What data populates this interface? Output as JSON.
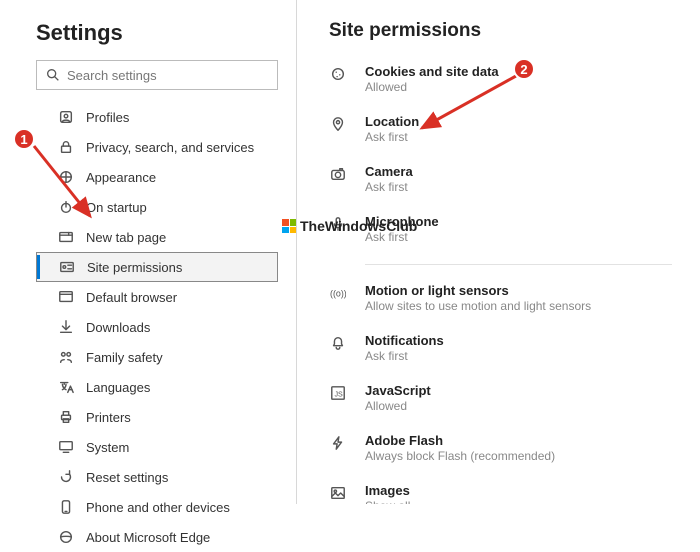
{
  "sidebar": {
    "title": "Settings",
    "search_placeholder": "Search settings",
    "items": [
      {
        "label": "Profiles",
        "icon": "profile-icon"
      },
      {
        "label": "Privacy, search, and services",
        "icon": "lock-icon"
      },
      {
        "label": "Appearance",
        "icon": "appearance-icon"
      },
      {
        "label": "On startup",
        "icon": "power-icon"
      },
      {
        "label": "New tab page",
        "icon": "newtab-icon"
      },
      {
        "label": "Site permissions",
        "icon": "permissions-icon",
        "selected": true
      },
      {
        "label": "Default browser",
        "icon": "browser-icon"
      },
      {
        "label": "Downloads",
        "icon": "download-icon"
      },
      {
        "label": "Family safety",
        "icon": "family-icon"
      },
      {
        "label": "Languages",
        "icon": "language-icon"
      },
      {
        "label": "Printers",
        "icon": "printer-icon"
      },
      {
        "label": "System",
        "icon": "system-icon"
      },
      {
        "label": "Reset settings",
        "icon": "reset-icon"
      },
      {
        "label": "Phone and other devices",
        "icon": "phone-icon"
      },
      {
        "label": "About Microsoft Edge",
        "icon": "edge-icon"
      }
    ]
  },
  "main": {
    "heading": "Site permissions",
    "permissions": [
      {
        "title": "Cookies and site data",
        "sub": "Allowed",
        "icon": "cookie-icon"
      },
      {
        "title": "Location",
        "sub": "Ask first",
        "icon": "location-icon"
      },
      {
        "title": "Camera",
        "sub": "Ask first",
        "icon": "camera-icon"
      },
      {
        "title": "Microphone",
        "sub": "Ask first",
        "icon": "mic-icon"
      },
      {
        "title": "Motion or light sensors",
        "sub": "Allow sites to use motion and light sensors",
        "icon": "sensor-icon",
        "after_divider": true
      },
      {
        "title": "Notifications",
        "sub": "Ask first",
        "icon": "bell-icon"
      },
      {
        "title": "JavaScript",
        "sub": "Allowed",
        "icon": "js-icon"
      },
      {
        "title": "Adobe Flash",
        "sub": "Always block Flash (recommended)",
        "icon": "flash-icon"
      },
      {
        "title": "Images",
        "sub": "Show all",
        "icon": "image-icon"
      }
    ]
  },
  "annotations": {
    "badge1": "1",
    "badge2": "2",
    "watermark": "TheWindowsClub"
  },
  "colors": {
    "accent": "#0078d4",
    "annotation": "#d93025"
  }
}
